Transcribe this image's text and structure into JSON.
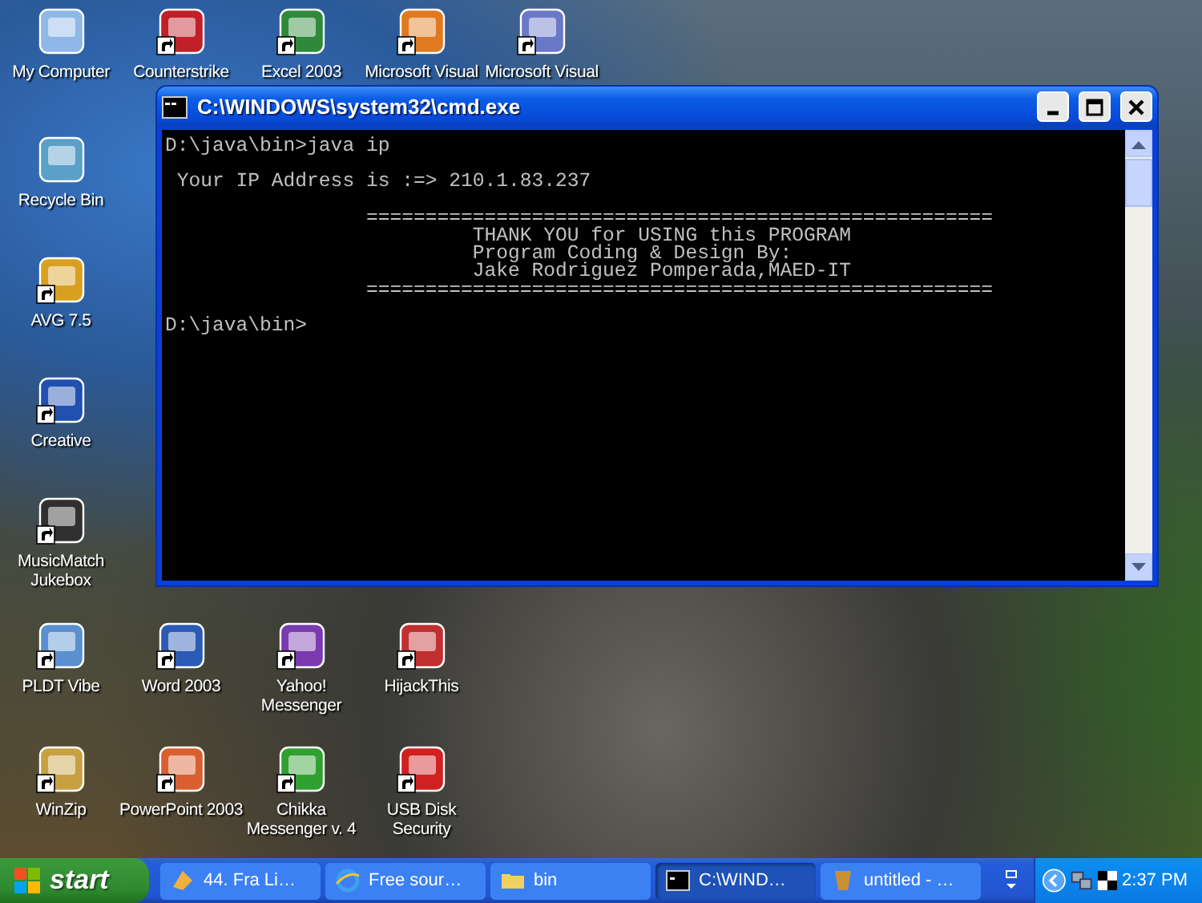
{
  "desktop": {
    "icons": [
      {
        "label": "My Computer",
        "shortcut": false
      },
      {
        "label": "Counterstrike",
        "shortcut": true
      },
      {
        "label": "Excel 2003",
        "shortcut": true
      },
      {
        "label": "Microsoft Visual",
        "shortcut": true
      },
      {
        "label": "Microsoft Visual",
        "shortcut": true
      },
      {
        "label": "Recycle Bin",
        "shortcut": false
      },
      {
        "label": "AVG 7.5",
        "shortcut": true
      },
      {
        "label": "Creative",
        "shortcut": true
      },
      {
        "label": "MusicMatch Jukebox",
        "shortcut": true
      },
      {
        "label": "PLDT Vibe",
        "shortcut": true
      },
      {
        "label": "WinZip",
        "shortcut": true
      },
      {
        "label": "Word 2003",
        "shortcut": true
      },
      {
        "label": "Yahoo! Messenger",
        "shortcut": true
      },
      {
        "label": "HijackThis",
        "shortcut": true
      },
      {
        "label": "PowerPoint 2003",
        "shortcut": true
      },
      {
        "label": "Chikka Messenger v. 4",
        "shortcut": true
      },
      {
        "label": "USB Disk Security",
        "shortcut": true
      }
    ]
  },
  "console_window": {
    "title": "C:\\WINDOWS\\system32\\cmd.exe",
    "lines": [
      {
        "text": "D:\\java\\bin>java ip",
        "blank_before": false
      },
      {
        "text": " Your IP Address is :=> 210.1.83.237",
        "blank_before": true
      },
      {
        "text": "                 =====================================================",
        "blank_before": true
      },
      {
        "text": "                          THANK YOU for USING this PROGRAM",
        "blank_before": false
      },
      {
        "text": "                          Program Coding & Design By:",
        "blank_before": false
      },
      {
        "text": "                          Jake Rodriguez Pomperada,MAED-IT",
        "blank_before": false
      },
      {
        "text": "                 =====================================================",
        "blank_before": false
      },
      {
        "text": "D:\\java\\bin>",
        "blank_before": true
      }
    ]
  },
  "taskbar": {
    "start": "start",
    "tasks": [
      {
        "label": "44. Fra Li…",
        "selected": false
      },
      {
        "label": "Free sour…",
        "selected": false
      },
      {
        "label": "bin",
        "selected": false
      },
      {
        "label": "C:\\WIND…",
        "selected": true
      },
      {
        "label": "untitled - …",
        "selected": false
      }
    ],
    "clock": "2:37 PM"
  }
}
